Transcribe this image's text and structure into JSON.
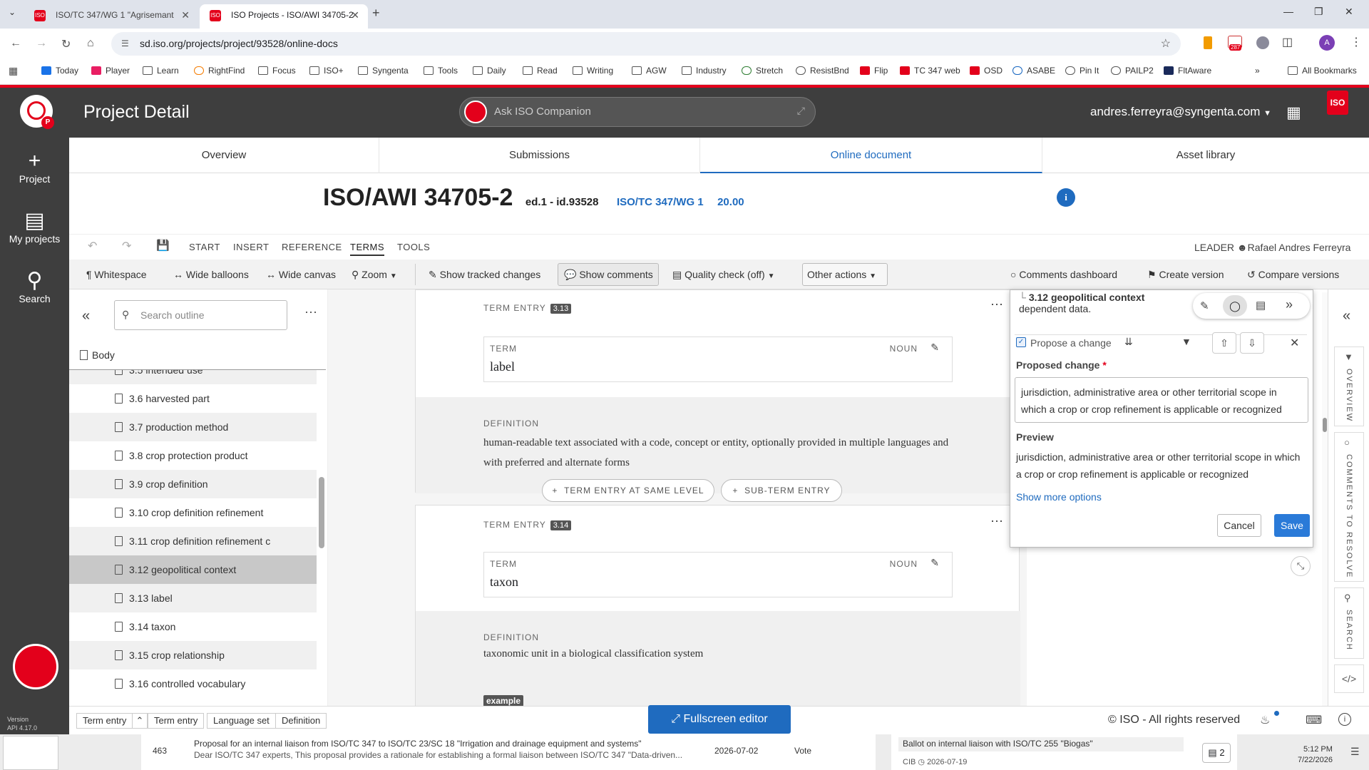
{
  "browser": {
    "tabs": [
      {
        "label": "ISO/TC 347/WG 1 \"Agrisemant"
      },
      {
        "label": "ISO Projects - ISO/AWI 34705-2"
      }
    ],
    "url": "sd.iso.org/projects/project/93528/online-docs",
    "bookmarks": [
      "Today",
      "Player",
      "Learn",
      "RightFind",
      "Focus",
      "ISO+",
      "Syngenta",
      "Tools",
      "Daily",
      "Read",
      "Writing",
      "AGW",
      "Industry",
      "Stretch",
      "ResistBnd",
      "Flip",
      "TC 347 web",
      "OSD",
      "ASABE",
      "Pin It",
      "PAILP2",
      "FltAware"
    ],
    "all_bookmarks": "All Bookmarks",
    "notification_count": "287",
    "profile_initial": "A"
  },
  "app": {
    "title": "Project Detail",
    "companion_placeholder": "Ask ISO Companion",
    "user_email": "andres.ferreyra@syngenta.com",
    "logo_text": "ISO",
    "rail": [
      {
        "label": "Project",
        "icon": "plus-icon"
      },
      {
        "label": "My projects",
        "icon": "inbox-icon"
      },
      {
        "label": "Search",
        "icon": "search-icon"
      }
    ],
    "version": "Version",
    "api_version": "API 4.17.0"
  },
  "project_tabs": [
    "Overview",
    "Submissions",
    "Online document",
    "Asset library"
  ],
  "document": {
    "title": "ISO/AWI 34705-2",
    "edition": "ed.1 - id.93528",
    "committee": "ISO/TC 347/WG 1",
    "stage": "20.00"
  },
  "ribbon": {
    "tabs": [
      "START",
      "INSERT",
      "REFERENCE",
      "TERMS",
      "TOOLS"
    ],
    "active": "TERMS",
    "leader_label": "LEADER",
    "leader_name": "Rafael Andres Ferreyra"
  },
  "toolbar": {
    "whitespace": "Whitespace",
    "wide_balloons": "Wide balloons",
    "wide_canvas": "Wide canvas",
    "zoom": "Zoom",
    "show_tracked": "Show tracked changes",
    "show_comments": "Show comments",
    "quality_check": "Quality check (off)",
    "other_actions": "Other actions",
    "comments_dashboard": "Comments dashboard",
    "create_version": "Create version",
    "compare_versions": "Compare versions"
  },
  "outline": {
    "search_placeholder": "Search outline",
    "root": "Body",
    "items": [
      "3.5 intended use",
      "3.6 harvested part",
      "3.7 production method",
      "3.8 crop protection product",
      "3.9 crop definition",
      "3.10 crop definition refinement",
      "3.11 crop definition refinement c",
      "3.12 geopolitical context",
      "3.13 label",
      "3.14 taxon",
      "3.15 crop relationship",
      "3.16 controlled vocabulary"
    ],
    "selected_index": 7
  },
  "entries": [
    {
      "heading": "TERM ENTRY",
      "number": "3.13",
      "term_label": "TERM",
      "pos": "NOUN",
      "term": "label",
      "def_label": "DEFINITION",
      "definition": "human-readable text associated with a code, concept or entity, optionally provided in multiple languages and with preferred and alternate forms"
    },
    {
      "heading": "TERM ENTRY",
      "number": "3.14",
      "term_label": "TERM",
      "pos": "NOUN",
      "term": "taxon",
      "def_label": "DEFINITION",
      "definition": "taxonomic unit in a biological classification system",
      "example": "example"
    }
  ],
  "add_buttons": {
    "same_level": "TERM ENTRY AT SAME LEVEL",
    "sub_term": "SUB-TERM ENTRY"
  },
  "comment_panel": {
    "context_title": "3.12 geopolitical context",
    "context_text": "dependent data.",
    "propose_label": "Propose a change",
    "proposed_change_label": "Proposed change",
    "required_mark": "*",
    "proposed_text": "jurisdiction, administrative area or other territorial scope in which a crop or crop refinement is applicable or recognized",
    "preview_label": "Preview",
    "preview_text": "jurisdiction, administrative area or other territorial scope in which a crop or crop refinement is applicable or recognized",
    "more_options": "Show more options",
    "cancel": "Cancel",
    "save": "Save"
  },
  "right_sidebar": [
    "OVERVIEW",
    "COMMENTS TO RESOLVE",
    "SEARCH"
  ],
  "status_bar": {
    "crumbs": [
      "Term entry",
      "Term entry",
      "Language set",
      "Definition"
    ],
    "fullscreen": "Fullscreen editor",
    "copyright": "© ISO - All rights reserved"
  },
  "below": {
    "row_number": "463",
    "row_title": "Proposal for an internal liaison from ISO/TC 347 to ISO/TC 23/SC 18 \"Irrigation and drainage equipment and systems\"",
    "row_sub": "Dear ISO/TC 347 experts, This proposal provides a rationale for establishing a formal liaison between ISO/TC 347 \"Data-driven...",
    "row_date": "2026-07-02",
    "row_type": "Vote",
    "ballot_title": "Ballot on internal liaison with ISO/TC 255 \"Biogas\"",
    "ballot_prefix": "CIB",
    "ballot_date": "2026-07-19",
    "ballot_count": "2"
  },
  "taskbar": {
    "time": "5:12 PM",
    "date": "7/22/2026"
  },
  "colors": {
    "iso_red": "#e3001b",
    "link_blue": "#1f6bbf",
    "dark": "#3e3e3e",
    "save_blue": "#2a7ad8"
  }
}
